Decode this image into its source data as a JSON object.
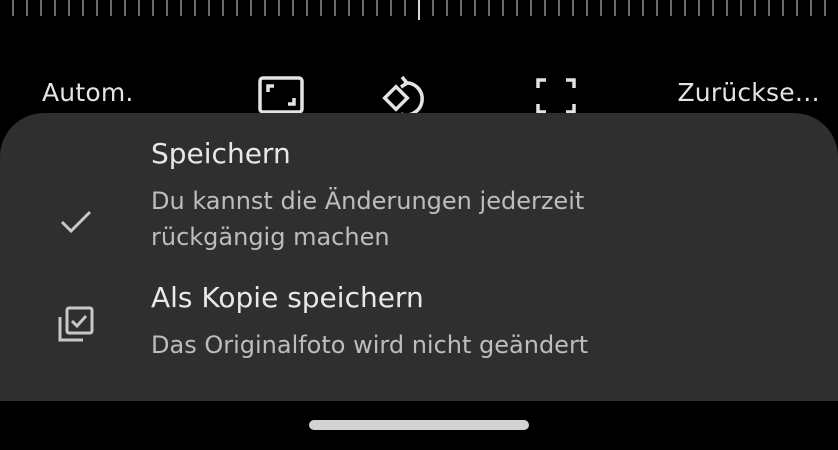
{
  "toolbar": {
    "auto_label": "Autom.",
    "reset_label": "Zurückse…",
    "icons": [
      "aspect-ratio-icon",
      "rotate-icon",
      "crop-free-icon"
    ]
  },
  "save_sheet": {
    "options": [
      {
        "title": "Speichern",
        "description": "Du kannst die Änderungen jederzeit rückgängig machen",
        "icon": "check-icon"
      },
      {
        "title": "Als Kopie speichern",
        "description": "Das Originalfoto wird nicht geändert",
        "icon": "library-add-check-icon"
      }
    ]
  },
  "colors": {
    "background": "#000000",
    "sheet": "#2f2f2f",
    "text_primary": "#e8e8e8",
    "text_secondary": "#bdbdbd"
  }
}
